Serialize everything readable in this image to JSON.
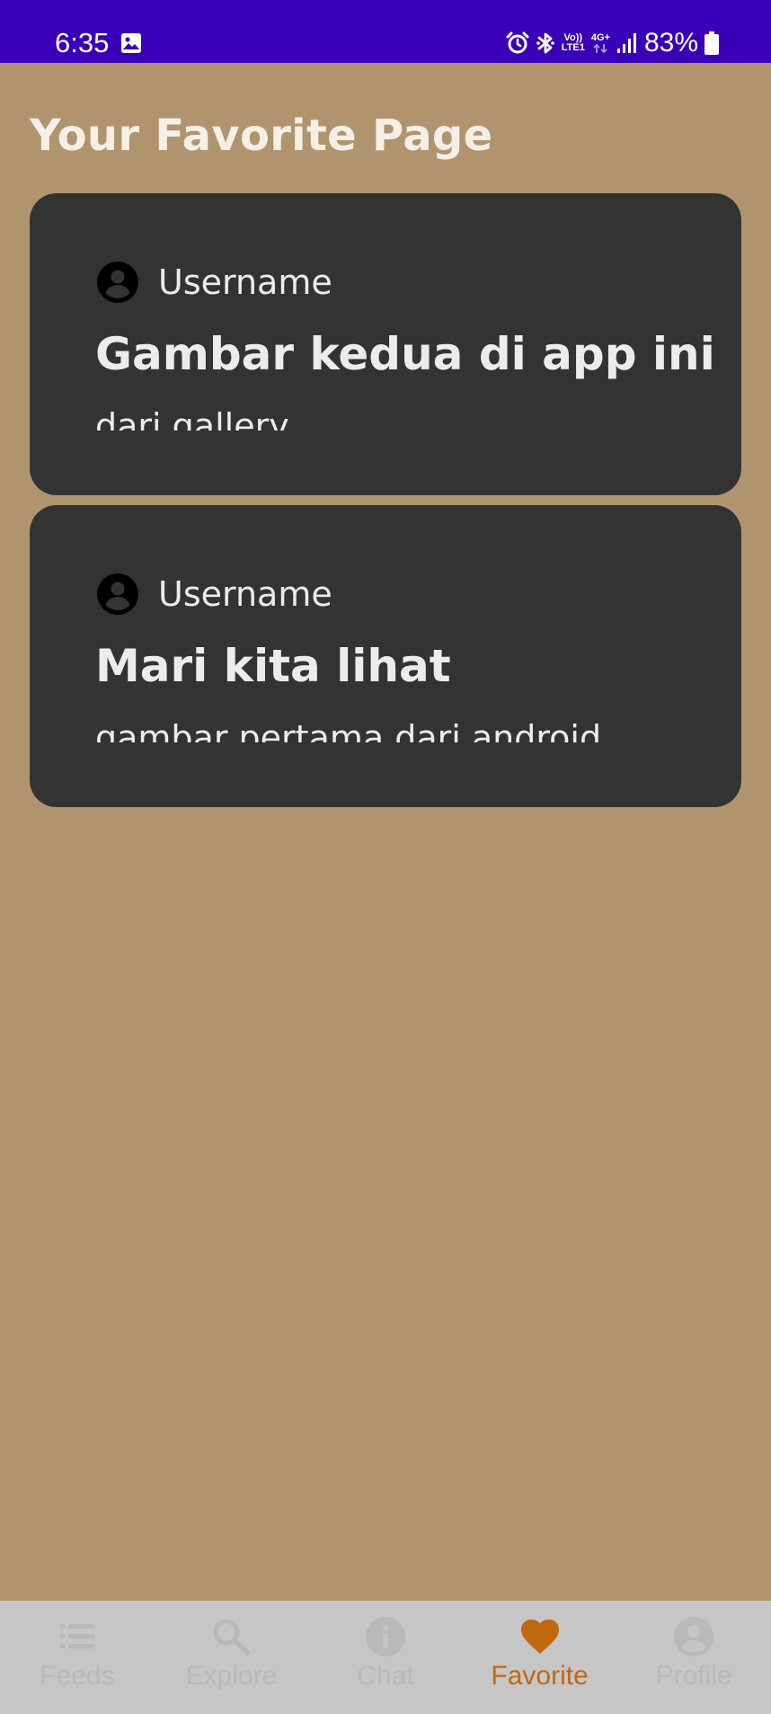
{
  "status_bar": {
    "time": "6:35",
    "volte_line1": "Vo))",
    "volte_line2": "LTE1",
    "network_type": "4G+",
    "battery_percent": "83%",
    "background_color": "#3a00b7",
    "icons": [
      "image-notification-icon",
      "alarm-icon",
      "bluetooth-icon",
      "volte-icon",
      "network-4g-icon",
      "signal-icon",
      "battery-icon"
    ]
  },
  "page": {
    "title": "Your Favorite Page",
    "background_color": "#b0946e"
  },
  "posts": [
    {
      "username": "Username",
      "title": "Gambar kedua di app ini",
      "subtitle": "dari gallery"
    },
    {
      "username": "Username",
      "title": "Mari kita lihat",
      "subtitle": "gambar pertama dari android"
    }
  ],
  "bottom_nav": {
    "active_color": "#c0680f",
    "inactive_color": "#b9b9b9",
    "items": [
      {
        "label": "Feeds",
        "icon": "list-icon",
        "active": false
      },
      {
        "label": "Explore",
        "icon": "search-icon",
        "active": false
      },
      {
        "label": "Chat",
        "icon": "info-icon",
        "active": false
      },
      {
        "label": "Favorite",
        "icon": "heart-icon",
        "active": true
      },
      {
        "label": "Profile",
        "icon": "account-circle-icon",
        "active": false
      }
    ]
  }
}
